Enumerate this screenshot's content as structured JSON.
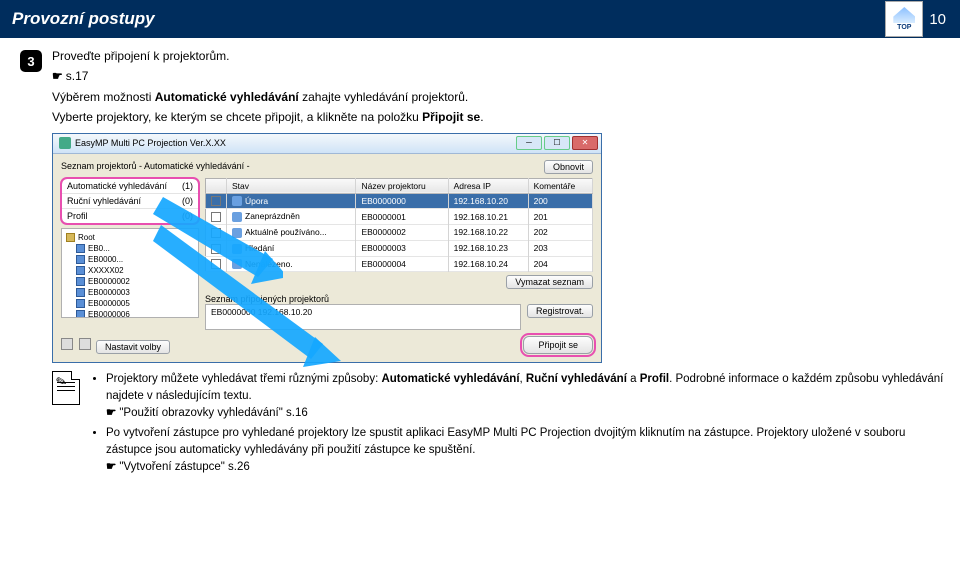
{
  "header": {
    "title": "Provozní postupy",
    "page_number": "10",
    "logo_text": "TOP"
  },
  "step": {
    "number": "3",
    "line1": "Proveďte připojení k projektorům.",
    "ref1": "s.17",
    "line2a": "Výběrem možnosti ",
    "line2b": "Automatické vyhledávání",
    "line2c": " zahajte vyhledávání projektorů.",
    "line3a": "Vyberte projektory, ke kterým se chcete připojit, a klikněte na položku ",
    "line3b": "Připojit se",
    "line3c": "."
  },
  "window": {
    "title": "EasyMP Multi PC Projection Ver.X.XX",
    "list_caption": "Seznam projektorů - Automatické vyhledávání -",
    "refresh_btn": "Obnovit",
    "search_modes": [
      {
        "label": "Automatické vyhledávání",
        "count": "(1)"
      },
      {
        "label": "Ruční vyhledávání",
        "count": "(0)"
      },
      {
        "label": "Profil",
        "count": "(0)"
      }
    ],
    "tree_root": "Root",
    "tree_items": [
      "EB0...",
      "EB0000...",
      "XXXXX02",
      "EB0000002",
      "EB0000003",
      "EB0000005",
      "EB0000006"
    ],
    "columns": {
      "c1": "",
      "c2": "Stav",
      "c3": "Název projektoru",
      "c4": "Adresa IP",
      "c5": "Komentáře"
    },
    "rows": [
      {
        "sel": true,
        "status": "Úpora",
        "name": "EB0000000",
        "ip": "192.168.10.20",
        "comment": "200"
      },
      {
        "sel": false,
        "status": "Zaneprázdněn",
        "name": "EB0000001",
        "ip": "192.168.10.21",
        "comment": "201"
      },
      {
        "sel": false,
        "status": "Aktuálně používáno...",
        "name": "EB0000002",
        "ip": "192.168.10.22",
        "comment": "202"
      },
      {
        "sel": false,
        "status": "Hledání",
        "name": "EB0000003",
        "ip": "192.168.10.23",
        "comment": "203"
      },
      {
        "sel": false,
        "status": "Nenalezeno.",
        "name": "EB0000004",
        "ip": "192.168.10.24",
        "comment": "204"
      }
    ],
    "clear_btn": "Vymazat seznam",
    "joined_caption": "Seznam připojených projektorů",
    "joined_text": "EB0000000 192.168.10.20",
    "register_btn": "Registrovat.",
    "options_btn": "Nastavit volby",
    "connect_btn": "Připojit se"
  },
  "note": {
    "bullet1a": "Projektory můžete vyhledávat třemi různými způsoby: ",
    "bullet1b": "Automatické vyhledávání",
    "bullet1c": ", ",
    "bullet1d": "Ruční vyhledávání",
    "bullet1e": " a ",
    "bullet1f": "Profil",
    "bullet1g": ". Podrobné informace o každém způsobu vyhledávání najdete v následujícím textu.",
    "ref1": "\"Použití obrazovky vyhledávání\" s.16",
    "bullet2": "Po vytvoření zástupce pro vyhledané projektory lze spustit aplikaci EasyMP Multi PC Projection dvojitým kliknutím na zástupce. Projektory uložené v souboru zástupce jsou automaticky vyhledávány při použití zástupce ke spuštění.",
    "ref2": "\"Vytvoření zástupce\" s.26"
  }
}
